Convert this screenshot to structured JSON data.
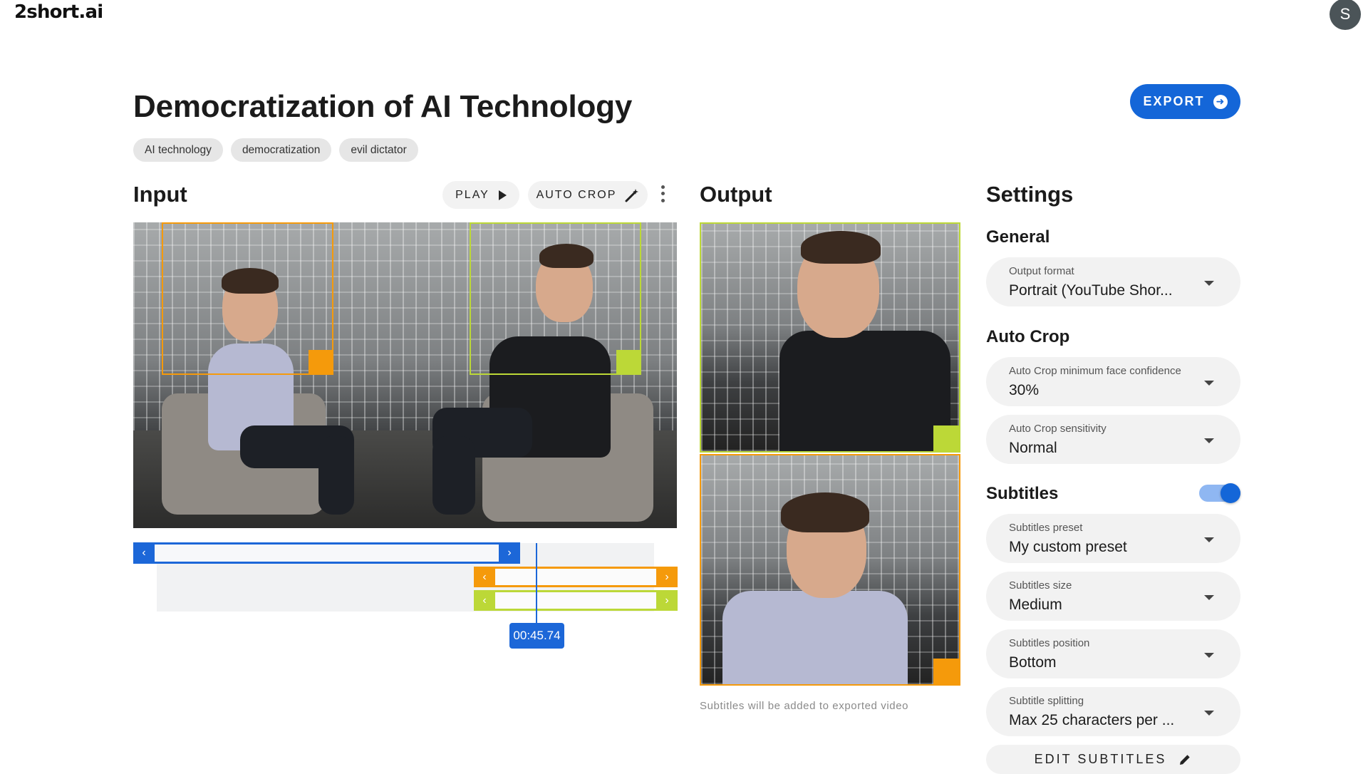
{
  "header": {
    "logo": "2short.ai",
    "avatar_initial": "S"
  },
  "project": {
    "title": "Democratization of AI Technology",
    "tags": [
      "AI technology",
      "democratization",
      "evil dictator"
    ],
    "export_label": "EXPORT",
    "export_icon": "arrow-right-circle-icon"
  },
  "input": {
    "heading": "Input",
    "play_label": "PLAY",
    "auto_crop_label": "AUTO CROP",
    "current_time": "00:45.74"
  },
  "output": {
    "heading": "Output",
    "note": "Subtitles will be added to exported video"
  },
  "colors": {
    "accent": "#1466d8",
    "crop_orange": "#f59a0b",
    "crop_lime": "#bcd837"
  },
  "settings": {
    "heading": "Settings",
    "general": {
      "heading": "General",
      "output_format": {
        "label": "Output format",
        "value": "Portrait (YouTube Shor..."
      }
    },
    "auto_crop": {
      "heading": "Auto Crop",
      "confidence": {
        "label": "Auto Crop minimum face confidence",
        "value": "30%"
      },
      "sensitivity": {
        "label": "Auto Crop sensitivity",
        "value": "Normal"
      }
    },
    "subtitles": {
      "heading": "Subtitles",
      "enabled": true,
      "preset": {
        "label": "Subtitles preset",
        "value": "My custom preset"
      },
      "size": {
        "label": "Subtitles size",
        "value": "Medium"
      },
      "position": {
        "label": "Subtitles position",
        "value": "Bottom"
      },
      "splitting": {
        "label": "Subtitle splitting",
        "value": "Max 25 characters per ..."
      },
      "edit_label": "EDIT SUBTITLES"
    }
  }
}
